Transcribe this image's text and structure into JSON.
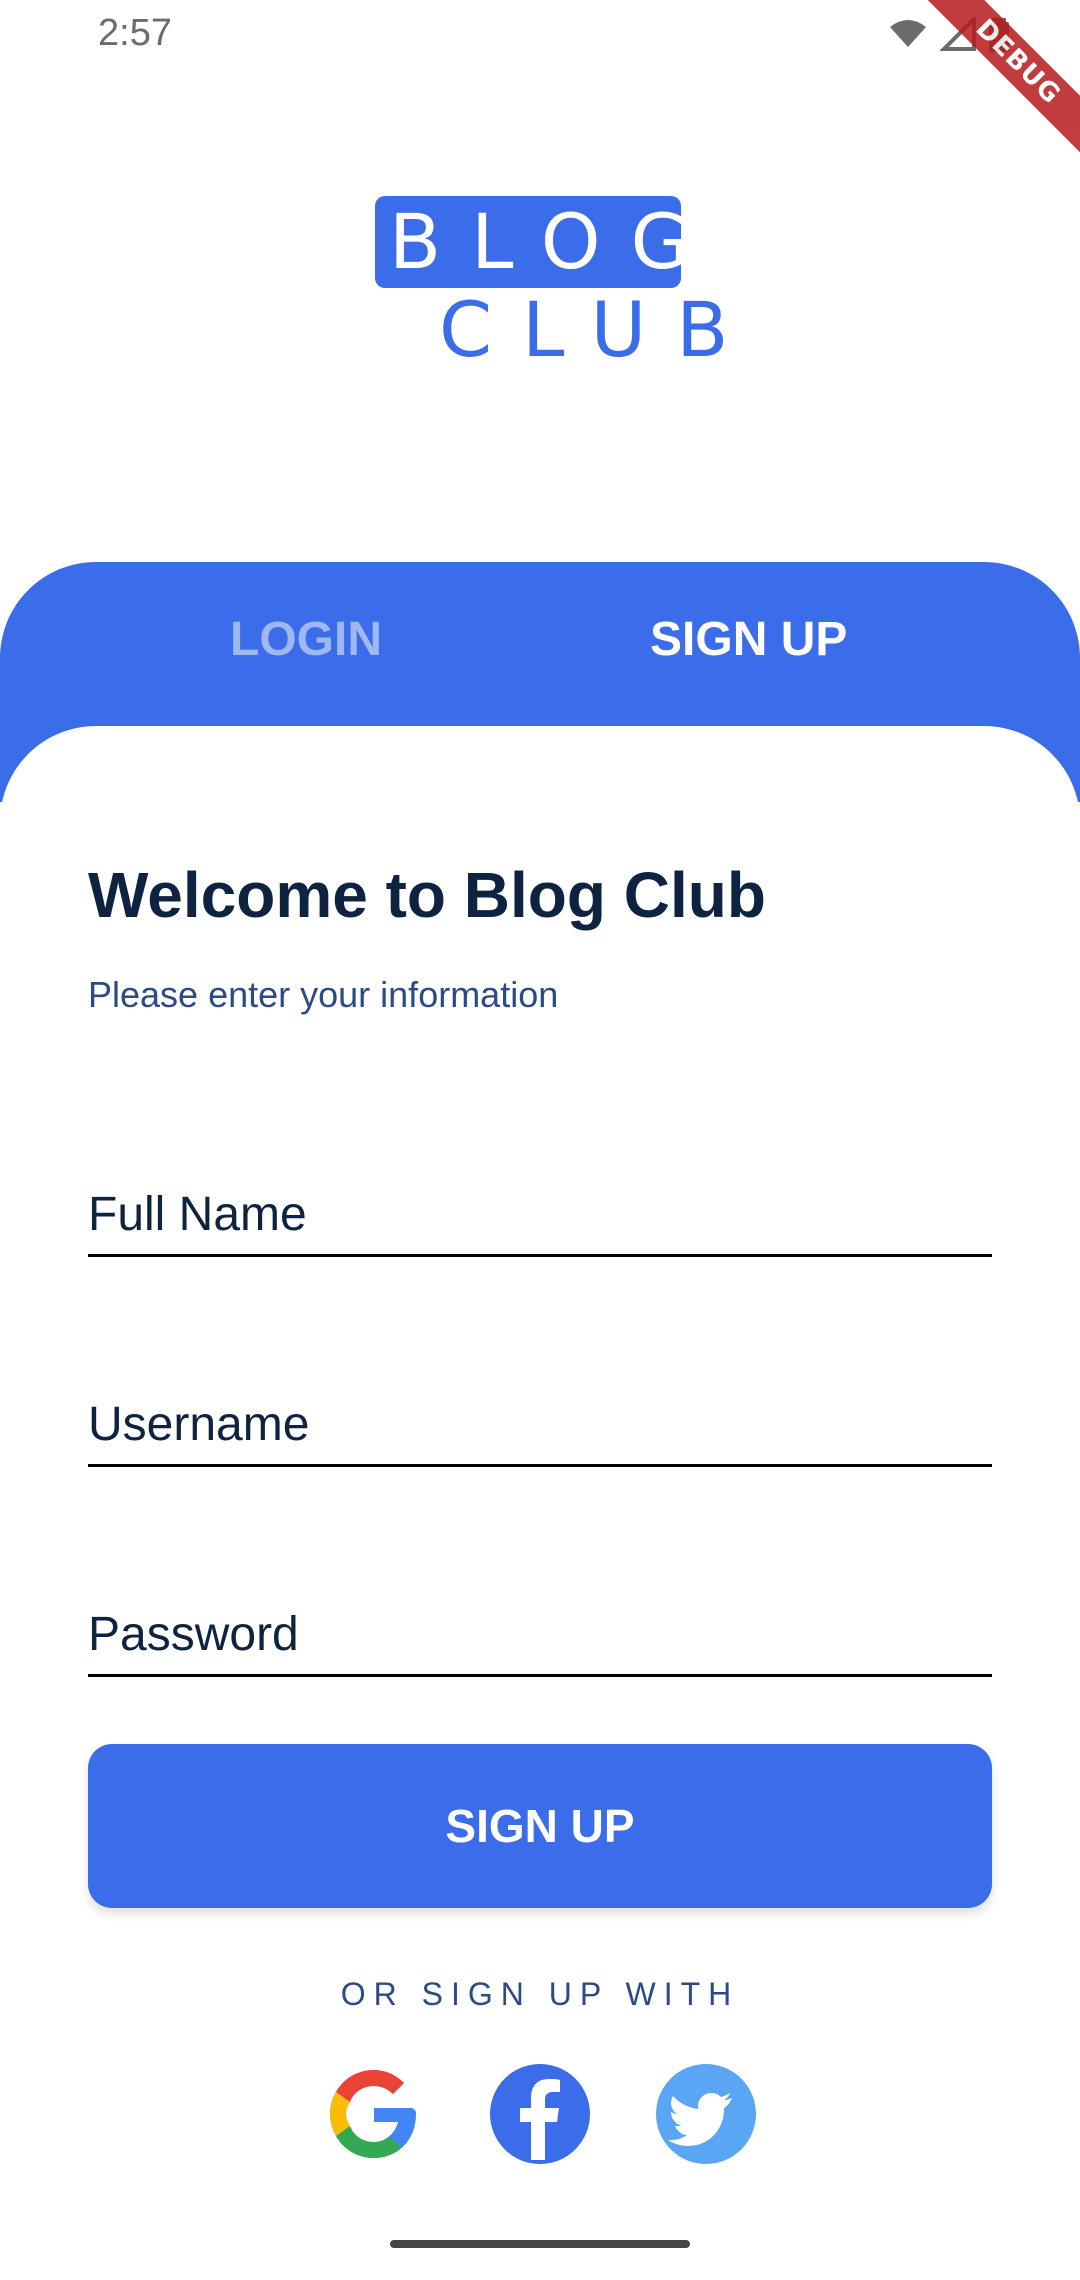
{
  "status_bar": {
    "time": "2:57",
    "debug_label": "DEBUG"
  },
  "logo": {
    "line1": "BLOG",
    "line2": "CLUB"
  },
  "tabs": {
    "login": "LOGIN",
    "signup": "SIGN UP"
  },
  "form": {
    "title": "Welcome to Blog Club",
    "subtitle": "Please enter your information",
    "fields": [
      {
        "placeholder": "Full Name"
      },
      {
        "placeholder": "Username"
      },
      {
        "placeholder": "Password"
      }
    ],
    "submit_label": "SIGN UP"
  },
  "social": {
    "label": "OR SIGN UP WITH",
    "providers": [
      {
        "icon": "google-icon",
        "color": "#ffffff"
      },
      {
        "icon": "facebook-icon",
        "color": "#3b6ce9"
      },
      {
        "icon": "twitter-icon",
        "color": "#5aa6f5"
      }
    ]
  },
  "colors": {
    "primary": "#3b6ce9",
    "tab_inactive": "#9fb7f3",
    "text_dark": "#0d233f",
    "text_secondary": "#2c4a86"
  }
}
